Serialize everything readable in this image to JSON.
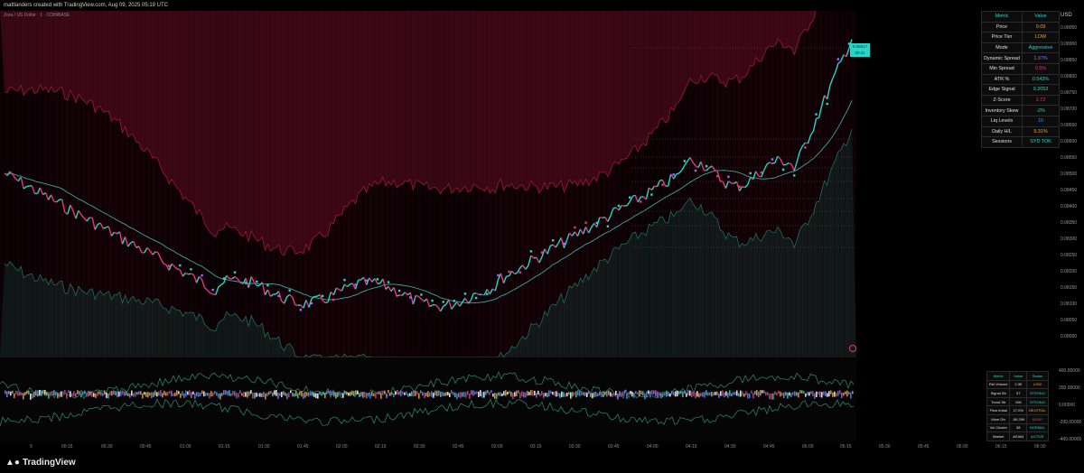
{
  "header": {
    "credit": "mattlanders created with TradingView.com, Aug 09, 2025 05:19 UTC",
    "symbol_line": "Zora / US Dollar · 1 · COINBASE"
  },
  "price_axis": {
    "currency": "USD",
    "labels": [
      "0.08950",
      "0.08900",
      "0.08850",
      "0.08800",
      "0.08750",
      "0.08700",
      "0.08650",
      "0.08600",
      "0.08550",
      "0.08500",
      "0.08450",
      "0.08400",
      "0.08350",
      "0.08300",
      "0.08250",
      "0.08200",
      "0.08150",
      "0.08100",
      "0.08050",
      "0.08000"
    ],
    "badge_upper": "0.08917",
    "badge_lower": "00:41"
  },
  "oscillator_axis": {
    "labels": [
      "400.00000",
      "200.00000",
      "0.00000",
      "-200.00000",
      "-400.00000"
    ]
  },
  "time_axis": {
    "labels": [
      "9",
      "00:15",
      "00:30",
      "00:45",
      "01:00",
      "01:15",
      "01:30",
      "01:45",
      "02:00",
      "02:15",
      "02:30",
      "02:45",
      "03:00",
      "03:15",
      "03:30",
      "03:45",
      "04:00",
      "04:15",
      "04:30",
      "04:45",
      "05:00",
      "05:15",
      "05:30",
      "05:45",
      "06:00",
      "06:15",
      "06:30"
    ]
  },
  "metrics_table": {
    "headers": [
      "Metric",
      "Value"
    ],
    "rows": [
      {
        "metric": "Price",
        "value": "0.09",
        "color": "#f5a623"
      },
      {
        "metric": "Price Tier",
        "value": "LOW",
        "color": "#f5a623"
      },
      {
        "metric": "Mode",
        "value": "Aggressive",
        "color": "#27d6c9"
      },
      {
        "metric": "Dynamic Spread",
        "value": "1.07%",
        "color": "#9b6dff"
      },
      {
        "metric": "Min Spread",
        "value": "0.5%",
        "color": "#e33a7a"
      },
      {
        "metric": "ATR %",
        "value": "0.543%",
        "color": "#27d6c9"
      },
      {
        "metric": "Edge Signal",
        "value": "0.2053",
        "color": "#27d6c9"
      },
      {
        "metric": "Z-Score",
        "value": "1.72",
        "color": "#e33a7a"
      },
      {
        "metric": "Inventory Skew",
        "value": "-2%",
        "color": "#27d6c9"
      },
      {
        "metric": "Liq Levels",
        "value": "10",
        "color": "#3c8cff"
      },
      {
        "metric": "Daily H/L",
        "value": "9.31%",
        "color": "#f5a623"
      },
      {
        "metric": "Sessions",
        "value": "SYD TOK",
        "color": "#27d6c9"
      }
    ]
  },
  "status_table": {
    "headers": [
      "Metric",
      "Value",
      "Status"
    ],
    "rows": [
      {
        "metric": "Rel Volume",
        "value": "0.39",
        "status": "LOW",
        "color": "#f5a623"
      },
      {
        "metric": "Signal Str",
        "value": "97",
        "status": "STRONG",
        "color": "#27d6c9"
      },
      {
        "metric": "Trend Str",
        "value": "106",
        "status": "STRONG",
        "color": "#27d6c9"
      },
      {
        "metric": "Flow Imbal",
        "value": "17.0%",
        "status": "NEUTRAL",
        "color": "#f5a623"
      },
      {
        "metric": "Mom Div",
        "value": "-90.299",
        "status": "BEAR",
        "color": "#e33a7a"
      },
      {
        "metric": "Vol Cluster",
        "value": "38",
        "status": "NORMAL",
        "color": "#27d6c9"
      },
      {
        "metric": "Market",
        "value": "ASIAN",
        "status": "ACTIVE",
        "color": "#27d6c9"
      }
    ]
  },
  "colors": {
    "teal": "#27d6c9",
    "magenta": "#e33a7a",
    "purple": "#9b6dff",
    "band_red": "#8a1535",
    "band_green": "#1f6b5c"
  },
  "branding": {
    "logo_text": "TradingView"
  }
}
